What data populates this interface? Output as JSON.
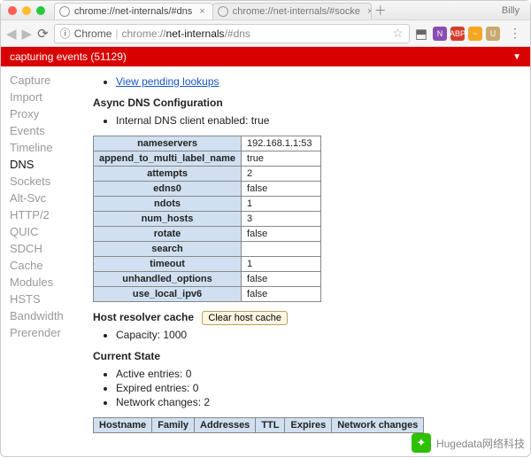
{
  "window": {
    "profile": "Billy",
    "tabs": [
      {
        "title": "chrome://net-internals/#dns",
        "active": true
      },
      {
        "title": "chrome://net-internals/#socke",
        "active": false
      }
    ]
  },
  "omnibox": {
    "prefix": "Chrome",
    "host_pre": "chrome://",
    "host_bold": "net-internals",
    "path": "/#dns"
  },
  "banner": {
    "text": "capturing events (51129)"
  },
  "sidebar": {
    "items": [
      "Capture",
      "Import",
      "Proxy",
      "Events",
      "Timeline",
      "DNS",
      "Sockets",
      "Alt-Svc",
      "HTTP/2",
      "QUIC",
      "SDCH",
      "Cache",
      "Modules",
      "HSTS",
      "Bandwidth",
      "Prerender"
    ],
    "active": "DNS"
  },
  "pending_link": "View pending lookups",
  "heading_async": "Async DNS Configuration",
  "dns_client_line": "Internal DNS client enabled: true",
  "cfg": [
    {
      "k": "nameservers",
      "v": "192.168.1.1:53"
    },
    {
      "k": "append_to_multi_label_name",
      "v": "true"
    },
    {
      "k": "attempts",
      "v": "2"
    },
    {
      "k": "edns0",
      "v": "false"
    },
    {
      "k": "ndots",
      "v": "1"
    },
    {
      "k": "num_hosts",
      "v": "3"
    },
    {
      "k": "rotate",
      "v": "false"
    },
    {
      "k": "search",
      "v": ""
    },
    {
      "k": "timeout",
      "v": "1"
    },
    {
      "k": "unhandled_options",
      "v": "false"
    },
    {
      "k": "use_local_ipv6",
      "v": "false"
    }
  ],
  "hrc_label": "Host resolver cache",
  "clear_btn": "Clear host cache",
  "capacity_line": "Capacity: 1000",
  "heading_state": "Current State",
  "state_lines": [
    "Active entries: 0",
    "Expired entries: 0",
    "Network changes: 2"
  ],
  "state_headers": [
    "Hostname",
    "Family",
    "Addresses",
    "TTL",
    "Expires",
    "Network changes"
  ],
  "watermark": "Hugedata网络科技"
}
